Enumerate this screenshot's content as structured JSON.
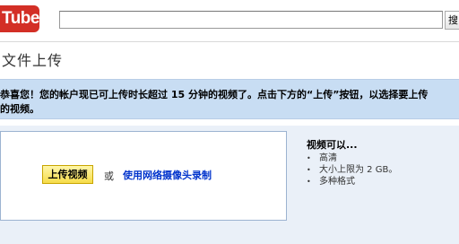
{
  "header": {
    "logo_text": "Tube",
    "search_placeholder": "",
    "search_button_label": "搜"
  },
  "page_title": "文件上传",
  "notice": {
    "line1": "恭喜您！您的帐户现已可上传时长超过 15 分钟的视频了。点击下方的“上传”按钮，以选择要上传",
    "line2": "的视频。"
  },
  "upload": {
    "button_label": "上传视频",
    "or_text": "或",
    "webcam_link": "使用网络摄像头录制"
  },
  "info": {
    "title": "视频可以...",
    "items": [
      "高清",
      "大小上限为 2 GB。",
      "多种格式"
    ]
  }
}
